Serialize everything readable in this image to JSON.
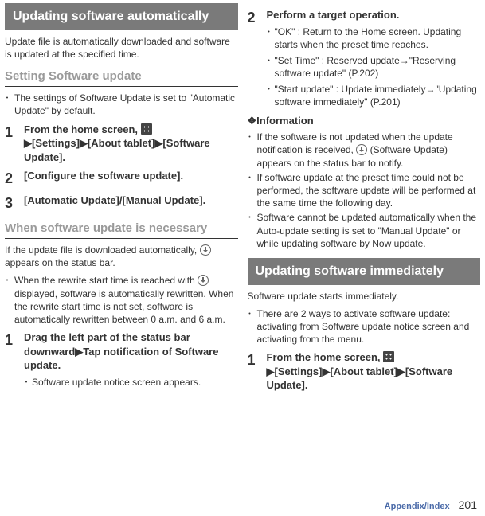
{
  "left": {
    "bar1": "Updating software automatically",
    "intro": "Update file is automatically downloaded and software is updated at the specified time.",
    "sub1": "Setting Software update",
    "b1": "The settings of Software Update is set to \"Automatic Update\" by default.",
    "s1_pre": "From the home screen, ",
    "s1_post": "▶[Settings]▶[About tablet]▶[Software Update].",
    "s2": "[Configure the software update].",
    "s3": "[Automatic Update]/[Manual Update].",
    "sub2": "When software update is necessary",
    "p2a": "If the update file is downloaded automatically, ",
    "p2b": " appears on the status bar.",
    "b2": "When the rewrite start time is reached with ",
    "b2b": " displayed, software is automatically rewritten. When the rewrite start time is not set, software is automatically rewritten between 0 a.m. and 6 a.m.",
    "s1b": "Drag the left part of the status bar downward▶Tap notification of Software update.",
    "s1b_sub": "Software update notice screen appears."
  },
  "right": {
    "s2_title": "Perform a target operation.",
    "s2_b1": "\"OK\" : Return to the Home screen. Updating starts when the preset time reaches.",
    "s2_b2": "\"Set Time\" : Reserved update→\"Reserving software update\" (P.202)",
    "s2_b3": "\"Start update\" : Update immediately→\"Updating software immediately\" (P.201)",
    "info_hd": "❖Information",
    "i1a": "If the software is not updated when the update notification is received, ",
    "i1b": " (Software Update) appears on the status bar to notify.",
    "i2": "If software update at the preset time could not be performed, the software update will be performed at the same time the following day.",
    "i3": "Software cannot be updated automatically when the Auto-update setting is set to \"Manual Update\" or while updating software by Now update.",
    "bar2": "Updating software immediately",
    "p3": "Software update starts immediately.",
    "b3": "There are 2 ways to activate software update: activating from Software update notice screen and activating from the menu.",
    "s1c_pre": "From the home screen, ",
    "s1c_post": "▶[Settings]▶[About tablet]▶[Software Update]."
  },
  "footer": {
    "section": "Appendix/Index",
    "page": "201"
  }
}
